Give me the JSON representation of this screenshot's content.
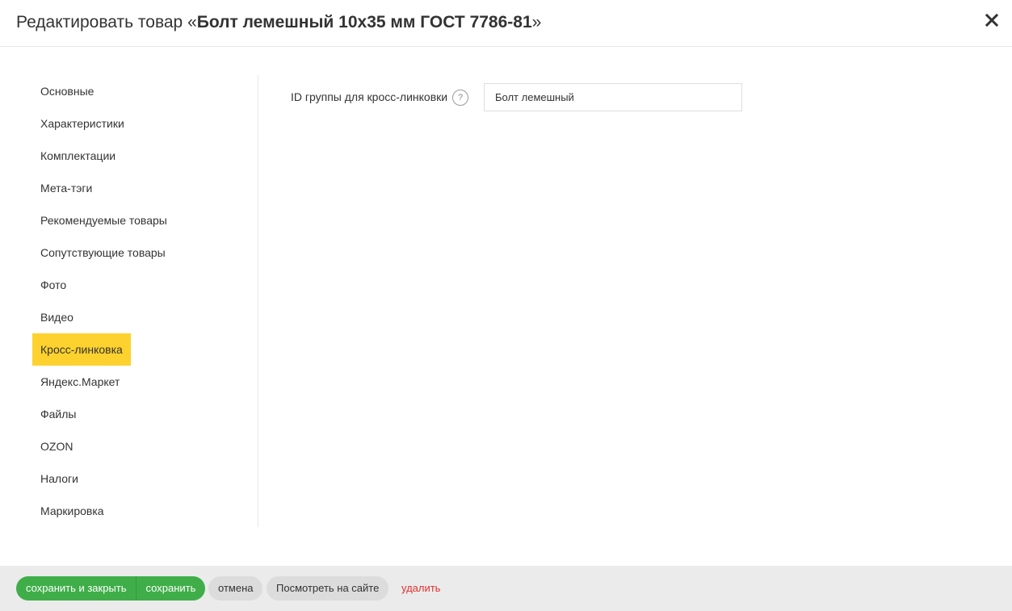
{
  "header": {
    "title_prefix": "Редактировать товар «",
    "title_product": "Болт лемешный 10x35 мм ГОСТ 7786-81",
    "title_suffix": "»",
    "close_icon": "close-icon"
  },
  "sidebar": {
    "items": [
      {
        "label": "Основные",
        "active": false
      },
      {
        "label": "Характеристики",
        "active": false
      },
      {
        "label": "Комплектации",
        "active": false
      },
      {
        "label": "Мета-тэги",
        "active": false
      },
      {
        "label": "Рекомендуемые товары",
        "active": false
      },
      {
        "label": "Сопутствующие товары",
        "active": false
      },
      {
        "label": "Фото",
        "active": false
      },
      {
        "label": "Видео",
        "active": false
      },
      {
        "label": "Кросс-линковка",
        "active": true
      },
      {
        "label": "Яндекс.Маркет",
        "active": false
      },
      {
        "label": "Файлы",
        "active": false
      },
      {
        "label": "OZON",
        "active": false
      },
      {
        "label": "Налоги",
        "active": false
      },
      {
        "label": "Маркировка",
        "active": false
      }
    ]
  },
  "main": {
    "crosslink_field": {
      "label": "ID группы для кросс-линковки",
      "help_glyph": "?",
      "value": "Болт лемешный",
      "placeholder": ""
    }
  },
  "footer": {
    "save_close_label": "сохранить и закрыть",
    "save_label": "сохранить",
    "cancel_label": "отмена",
    "view_on_site_label": "Посмотреть на сайте",
    "delete_label": "удалить"
  },
  "colors": {
    "accent_active": "#fdd22e",
    "primary_button": "#3fae49",
    "secondary_button": "#dcdcdc",
    "danger": "#e0322f",
    "footer_bg": "#ebebeb"
  }
}
